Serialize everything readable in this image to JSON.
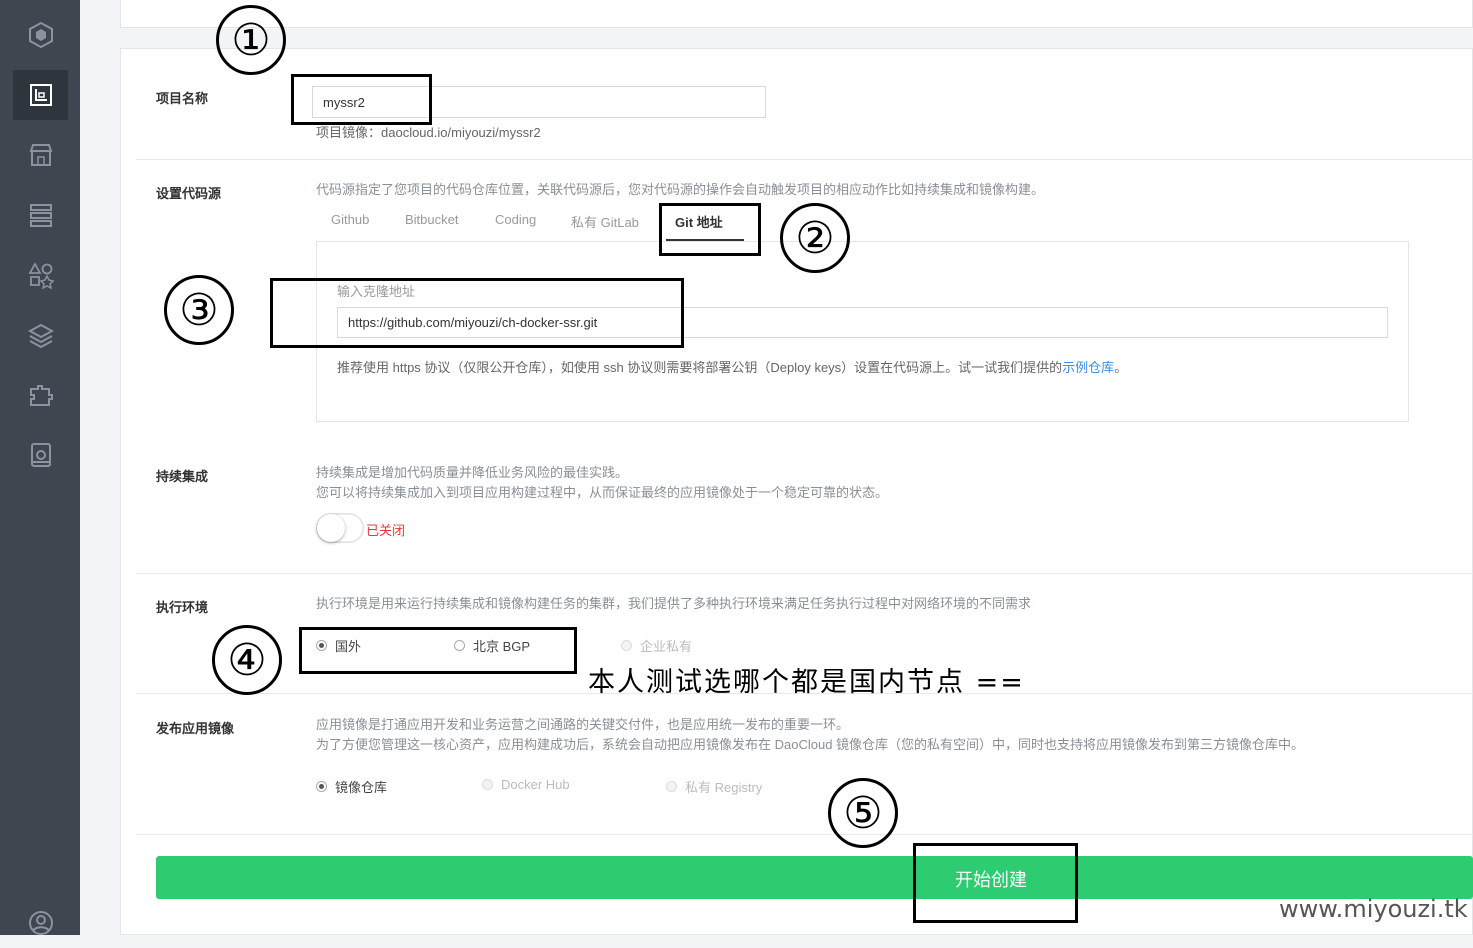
{
  "project": {
    "label": "项目名称",
    "name_value": "myssr2",
    "image_hint": "项目镜像：daocloud.io/miyouzi/myssr2"
  },
  "source": {
    "label": "设置代码源",
    "description": "代码源指定了您项目的代码仓库位置，关联代码源后，您对代码源的操作会自动触发项目的相应动作比如持续集成和镜像构建。",
    "tabs": [
      "Github",
      "Bitbucket",
      "Coding",
      "私有 GitLab",
      "Git 地址"
    ],
    "active_tab": "Git 地址",
    "clone_label": "输入克隆地址",
    "clone_value": "https://github.com/miyouzi/ch-docker-ssr.git",
    "hint_text": "推荐使用 https 协议（仅限公开仓库），如使用 ssh 协议则需要将部署公钥（Deploy keys）设置在代码源上。试一试我们提供的",
    "hint_link": "示例仓库",
    "hint_end": "。"
  },
  "ci": {
    "label": "持续集成",
    "desc_line1": "持续集成是增加代码质量并降低业务风险的最佳实践。",
    "desc_line2": "您可以将持续集成加入到项目应用构建过程中，从而保证最终的应用镜像处于一个稳定可靠的状态。",
    "toggle_state": "已关闭",
    "enabled": false
  },
  "runtime": {
    "label": "执行环境",
    "description": "执行环境是用来运行持续集成和镜像构建任务的集群，我们提供了多种执行环境来满足任务执行过程中对网络环境的不同需求",
    "options": [
      "国外",
      "北京 BGP",
      "企业私有"
    ],
    "selected": "国外"
  },
  "publish": {
    "label": "发布应用镜像",
    "desc_line1": "应用镜像是打通应用开发和业务运营之间通路的关键交付件，也是应用统一发布的重要一环。",
    "desc_line2": "为了方便您管理这一核心资产，应用构建成功后，系统会自动把应用镜像发布在 DaoCloud 镜像仓库（您的私有空间）中，同时也支持将应用镜像发布到第三方镜像仓库中。",
    "options": [
      "镜像仓库",
      "Docker Hub",
      "私有 Registry"
    ],
    "selected": "镜像仓库"
  },
  "create_button": "开始创建",
  "annotations": {
    "n1": "①",
    "n2": "②",
    "n3": "③",
    "n4": "④",
    "n5": "⑤",
    "note": "本人测试选哪个都是国内节点 ==",
    "watermark": "www.miyouzi.tk"
  },
  "sidebar_icons": [
    "logo-icon",
    "project-icon",
    "store-icon",
    "server-icon",
    "shapes-icon",
    "layers-icon",
    "puzzle-icon",
    "storage-icon",
    "user-icon"
  ],
  "colors": {
    "accent_green": "#2ecc71",
    "sidebar_bg": "#3f4650",
    "link_blue": "#3b8ee8",
    "off_red": "#e53935"
  }
}
